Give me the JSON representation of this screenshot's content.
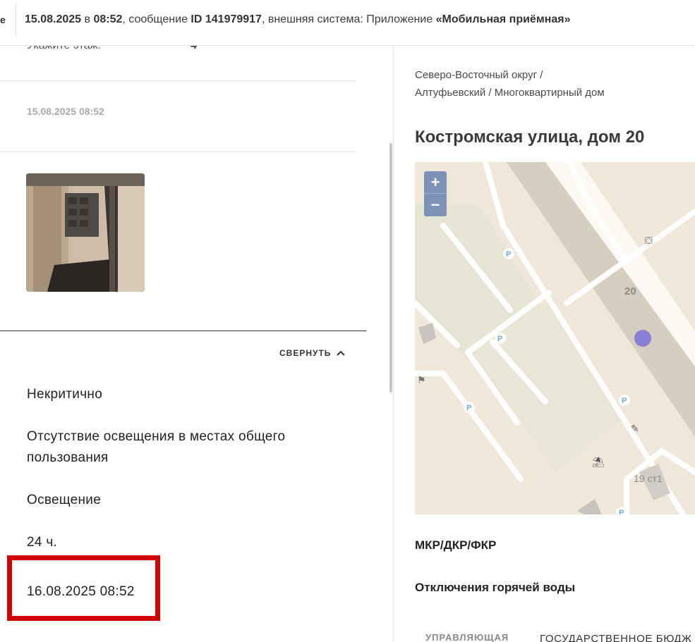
{
  "header": {
    "cut_label": "е",
    "date": "15.08.2025",
    "in_word": " в ",
    "time": "08:52",
    "msg_prefix": ", сообщение ",
    "msg_id": "ID 141979917",
    "ext_prefix": ", внешняя система: Приложение ",
    "ext_system": "«Мобильная приёмная»"
  },
  "left": {
    "floor_label": "Укажите этаж:",
    "floor_value": "4",
    "timestamp": "15.08.2025 08:52",
    "photo_alt": "photo-thumbnail",
    "collapse_label": "СВЕРНУТЬ",
    "criticality": "Некритично",
    "problem": "Отсутствие освещения в местах общего пользования",
    "category": "Освещение",
    "deadline": "24 ч.",
    "due_date": "16.08.2025 08:52"
  },
  "right": {
    "breadcrumb_line1": "Северо-Восточный округ /",
    "breadcrumb_line2": "Алтуфьевский / Многоквартирный дом",
    "address": "Костромская улица, дом 20",
    "map": {
      "zoom_in": "+",
      "zoom_out": "−",
      "building_label": "20",
      "building_label2": "19 ст1",
      "parking": "P"
    },
    "section1": "МКР/ДКР/ФКР",
    "section2": "Отключения горячей воды",
    "tab_label": "УПРАВЛЯЮЩАЯ",
    "tab_value": "ГОСУДАРСТВЕННОЕ БЮДЖ"
  },
  "colors": {
    "highlight": "#d10000",
    "map_marker": "#8a7fd4",
    "zoom_control": "#7d92b6"
  }
}
